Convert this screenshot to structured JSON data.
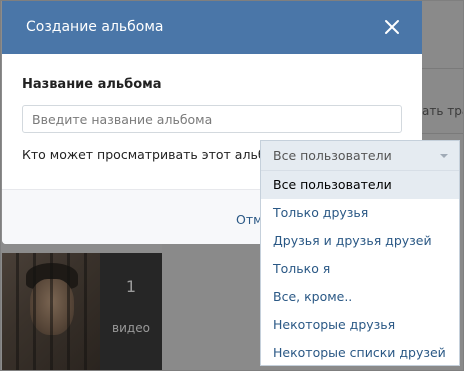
{
  "background": {
    "snippet_text": "ать тра"
  },
  "video_thumb": {
    "count": "1",
    "count_label": "видео"
  },
  "modal": {
    "title": "Создание альбома",
    "field_label": "Название альбома",
    "input_value": "",
    "input_placeholder": "Введите название альбома",
    "privacy_label": "Кто может просматривать этот альбом?",
    "cancel_label": "Отмена"
  },
  "dropdown": {
    "selected": "Все пользователи",
    "options": [
      "Все пользователи",
      "Только друзья",
      "Друзья и друзья друзей",
      "Только я",
      "Все, кроме..",
      "Некоторые друзья",
      "Некоторые списки друзей"
    ],
    "active_index": 0
  },
  "colors": {
    "header": "#4a76a8",
    "link": "#2a5885",
    "highlight": "#e5ebf1"
  },
  "icons": {
    "close": "close-icon",
    "dropdown": "chevron-down-icon"
  }
}
